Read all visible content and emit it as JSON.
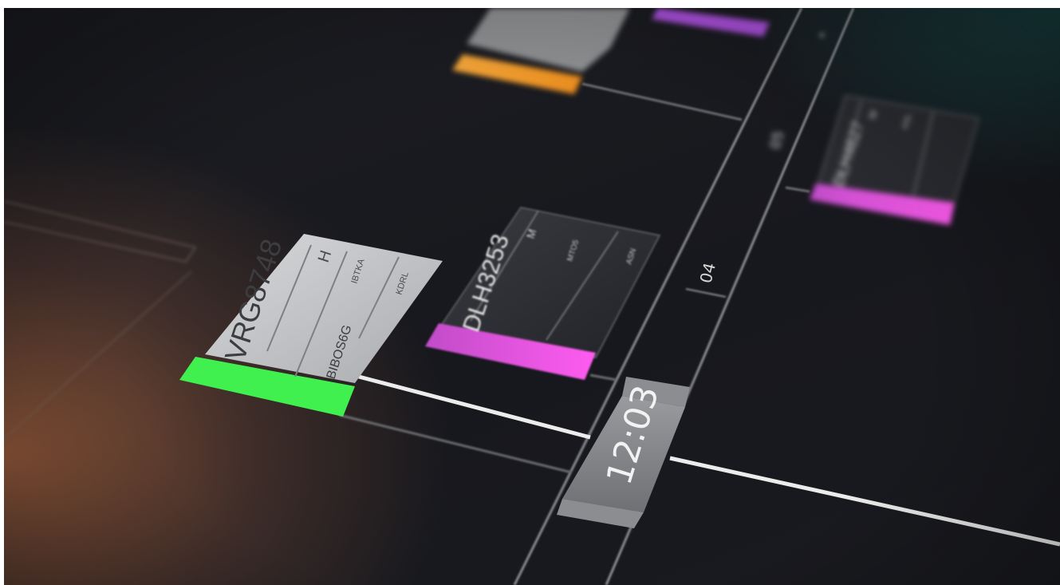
{
  "flights": [
    {
      "callsign": "VRG8748",
      "wake": "H",
      "field_a": "IBTKA",
      "field_b": "KDRL",
      "squawk": "BIBOS6G",
      "status_color": "#3ff04f"
    },
    {
      "callsign": "DLH3253",
      "wake": "M",
      "field_a": "MTO5",
      "field_b": "ASN",
      "status_color": "#e64fe6"
    },
    {
      "callsign": "DLH4627",
      "wake": "M",
      "field_a": "KDL",
      "status_color": "#c84fe8"
    }
  ],
  "top_strips": [
    {
      "accent_color": "#f0a030"
    },
    {
      "accent_color": "#a84fd8"
    }
  ],
  "timeline": {
    "current_time": "12:03",
    "minute_mark": "04",
    "far_mark": "05"
  },
  "colors": {
    "background": "#17181d",
    "timeline_line": "#e8e8e8",
    "grid_line": "#6a6c70"
  }
}
